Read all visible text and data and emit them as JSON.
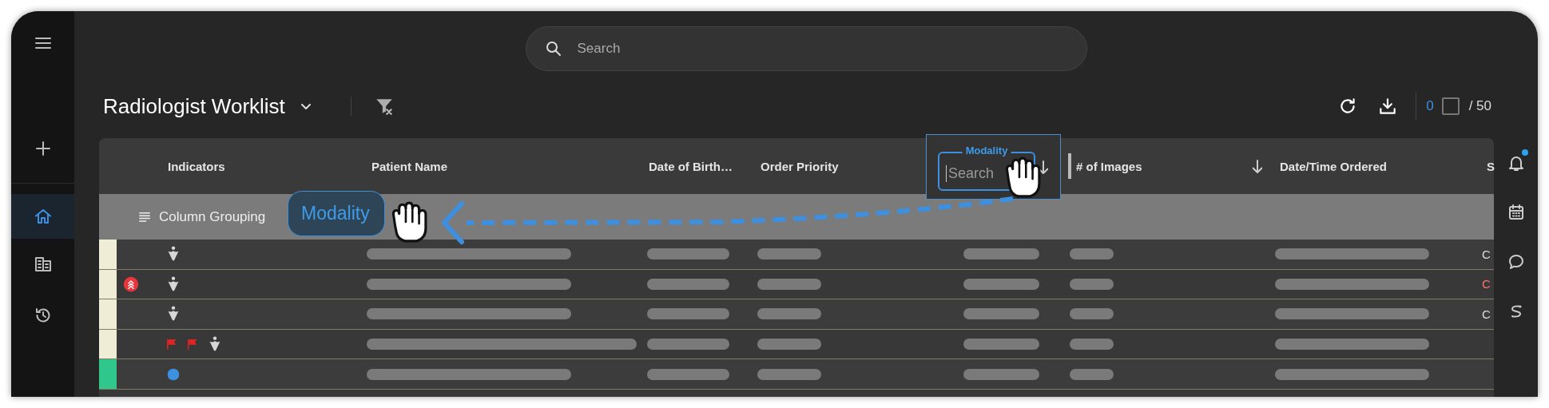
{
  "nav": [
    {
      "kind": "menu",
      "selected": false
    },
    {
      "kind": "add",
      "selected": false
    },
    {
      "kind": "home",
      "selected": true
    },
    {
      "kind": "building",
      "selected": false
    },
    {
      "kind": "history",
      "selected": false
    }
  ],
  "search": {
    "placeholder": "Search"
  },
  "title": "Radiologist Worklist",
  "toolbar": {
    "count": "0",
    "total": "/ 50",
    "select_all": {
      "checked": false
    }
  },
  "table": {
    "columns": [
      {
        "kind": "text",
        "label": "Indicators",
        "sorted": false
      },
      {
        "kind": "text",
        "label": "Patient Name",
        "sorted": false
      },
      {
        "kind": "text",
        "label": "Date of Birth…",
        "sorted": false
      },
      {
        "kind": "text",
        "label": "Order Priority",
        "sorted": false
      },
      {
        "kind": "filter",
        "label": "Modality",
        "placeholder": "Search",
        "sorted": true
      },
      {
        "kind": "text",
        "label": "# of Images",
        "sorted": true
      },
      {
        "kind": "text",
        "label": "Date/Time Ordered",
        "sorted": false
      },
      {
        "kind": "text",
        "label": "S",
        "sorted": false
      }
    ],
    "grouping": {
      "label": "Column Grouping"
    },
    "drag_chip": {
      "label": "Modality"
    },
    "rows": [
      {
        "color": "#efedd6",
        "indicators": [
          {
            "kind": "person"
          }
        ],
        "column_8": "C",
        "urgent": false
      },
      {
        "color": "#efedd6",
        "indicators": [
          {
            "kind": "priority"
          },
          {
            "kind": "person"
          }
        ],
        "column_8": "C",
        "urgent": true
      },
      {
        "color": "#efedd6",
        "indicators": [
          {
            "kind": "person"
          }
        ],
        "column_8": "C",
        "urgent": false
      },
      {
        "color": "#efedd6",
        "indicators": [
          {
            "kind": "flag"
          },
          {
            "kind": "flag"
          },
          {
            "kind": "person"
          }
        ]
      },
      {
        "color": "#2fc78b",
        "indicators": [
          {
            "kind": "dot"
          }
        ]
      }
    ]
  },
  "right_rail": [
    {
      "kind": "bell",
      "notification": true
    },
    {
      "kind": "calendar"
    },
    {
      "kind": "chat"
    },
    {
      "kind": "swap"
    }
  ]
}
